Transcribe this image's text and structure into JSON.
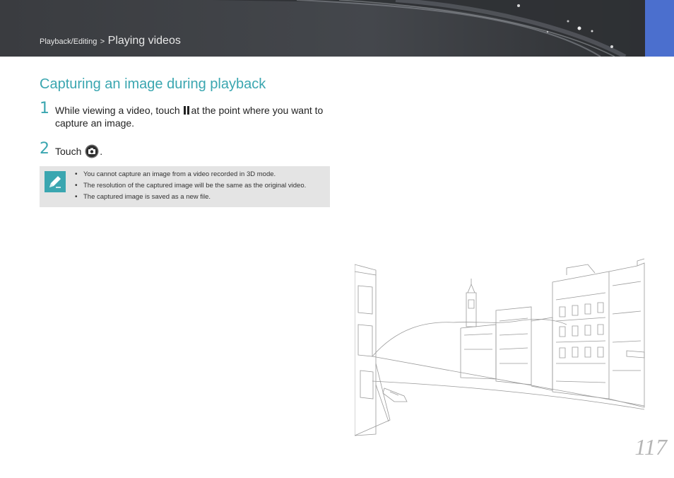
{
  "header": {
    "breadcrumb_section": "Playback/Editing",
    "breadcrumb_separator": ">",
    "breadcrumb_page": "Playing videos",
    "accent_color": "#4b6fce"
  },
  "section": {
    "title": "Capturing an image during playback",
    "title_color": "#3aa6b0"
  },
  "steps": [
    {
      "number": "1",
      "text_before_icon": "While viewing a video, touch",
      "icon": "pause-icon",
      "text_after_icon": "at the point where you want to capture an image."
    },
    {
      "number": "2",
      "text_before_icon": "Touch",
      "icon": "camera-capture-icon",
      "text_after_icon": "."
    }
  ],
  "note": {
    "icon": "pencil-note-icon",
    "items": [
      "You cannot capture an image from a video recorded in 3D mode.",
      "The resolution of the captured image will be the same as the original video.",
      "The captured image is saved as a new file."
    ]
  },
  "illustration": {
    "icon": "city-canal-sketch-illustration"
  },
  "page_number": "117"
}
